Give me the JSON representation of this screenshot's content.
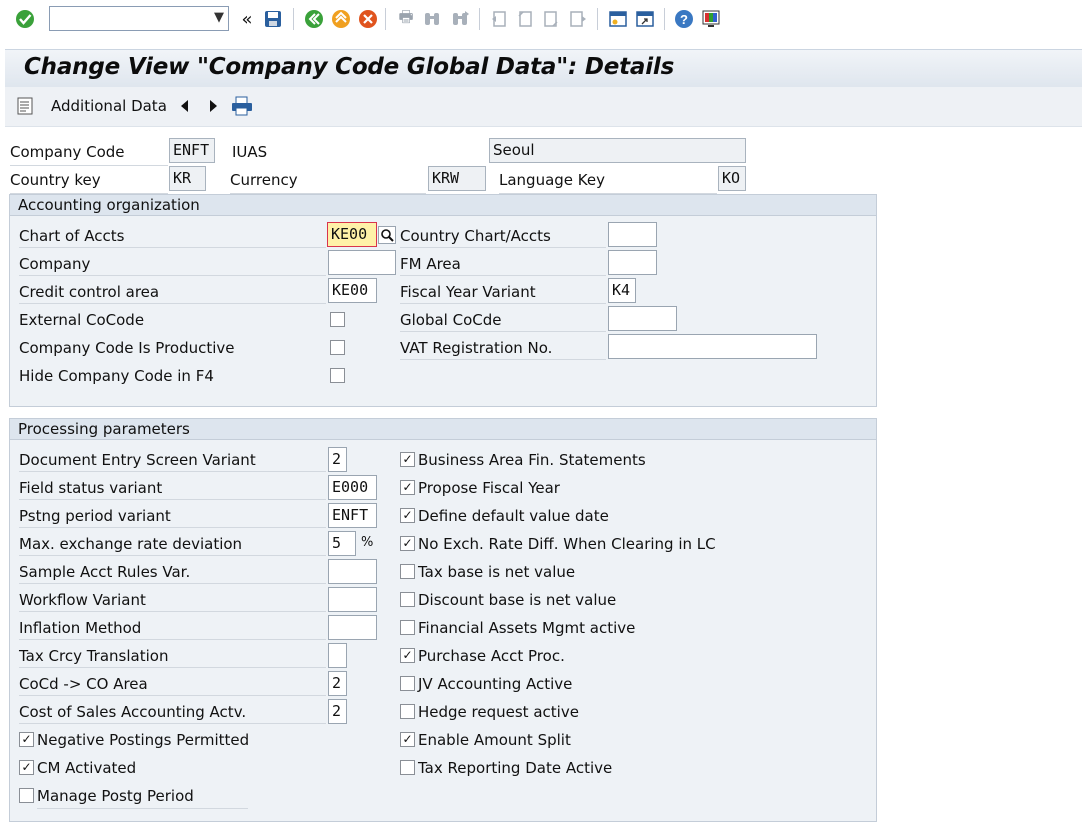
{
  "toolbar": {
    "command_field_value": "",
    "icons": [
      "enter-icon",
      "back-icon",
      "save-icon",
      "exit-icon",
      "cancel-icon",
      "print-icon",
      "find-icon",
      "find-next-icon",
      "first-page-icon",
      "prev-page-icon",
      "next-page-icon",
      "last-page-icon",
      "new-session-icon",
      "shortcut-icon",
      "help-icon",
      "layout-icon"
    ]
  },
  "title": "Change View \"Company Code Global Data\": Details",
  "app_toolbar": {
    "additional_data": "Additional Data"
  },
  "header": {
    "company_code_label": "Company Code",
    "company_code_value": "ENFT",
    "company_name": "IUAS",
    "city": "Seoul",
    "country_key_label": "Country key",
    "country_key_value": "KR",
    "currency_label": "Currency",
    "currency_value": "KRW",
    "language_key_label": "Language Key",
    "language_key_value": "KO"
  },
  "acct_org": {
    "title": "Accounting organization",
    "chart_of_accts_label": "Chart of Accts",
    "chart_of_accts_value": "KE00",
    "country_chart_label": "Country Chart/Accts",
    "country_chart_value": "",
    "company_label": "Company",
    "company_value": "",
    "fm_area_label": "FM Area",
    "fm_area_value": "",
    "credit_control_label": "Credit control area",
    "credit_control_value": "KE00",
    "fiscal_year_label": "Fiscal Year Variant",
    "fiscal_year_value": "K4",
    "external_cocode_label": "External CoCode",
    "external_cocode_checked": false,
    "global_cocde_label": "Global CoCde",
    "global_cocde_value": "",
    "productive_label": "Company Code Is Productive",
    "productive_checked": false,
    "vat_label": "VAT Registration No.",
    "vat_value": "",
    "hide_f4_label": "Hide Company Code in F4",
    "hide_f4_checked": false
  },
  "proc": {
    "title": "Processing parameters",
    "left": [
      {
        "label": "Document Entry Screen Variant",
        "value": "2"
      },
      {
        "label": "Field status variant",
        "value": "E000"
      },
      {
        "label": "Pstng period variant",
        "value": "ENFT"
      },
      {
        "label": "Max. exchange rate deviation",
        "value": "5",
        "unit": "%"
      },
      {
        "label": "Sample Acct Rules Var.",
        "value": ""
      },
      {
        "label": "Workflow Variant",
        "value": ""
      },
      {
        "label": "Inflation Method",
        "value": ""
      },
      {
        "label": "Tax Crcy Translation",
        "value": ""
      },
      {
        "label": "CoCd -> CO Area",
        "value": "2"
      },
      {
        "label": "Cost of Sales Accounting Actv.",
        "value": "2"
      }
    ],
    "left_checks": [
      {
        "label": "Negative Postings Permitted",
        "checked": true
      },
      {
        "label": "CM Activated",
        "checked": true
      },
      {
        "label": "Manage Postg Period",
        "checked": false
      }
    ],
    "right_checks": [
      {
        "label": "Business Area Fin. Statements",
        "checked": true
      },
      {
        "label": "Propose Fiscal Year",
        "checked": true
      },
      {
        "label": "Define default value date",
        "checked": true
      },
      {
        "label": "No Exch. Rate Diff. When Clearing in LC",
        "checked": true
      },
      {
        "label": "Tax base is net value",
        "checked": false
      },
      {
        "label": "Discount base is net value",
        "checked": false
      },
      {
        "label": "Financial Assets Mgmt active",
        "checked": false
      },
      {
        "label": "Purchase Acct Proc.",
        "checked": true
      },
      {
        "label": "JV Accounting Active",
        "checked": false
      },
      {
        "label": "Hedge request active",
        "checked": false
      },
      {
        "label": "Enable Amount Split",
        "checked": true
      },
      {
        "label": "Tax Reporting Date Active",
        "checked": false
      }
    ]
  }
}
